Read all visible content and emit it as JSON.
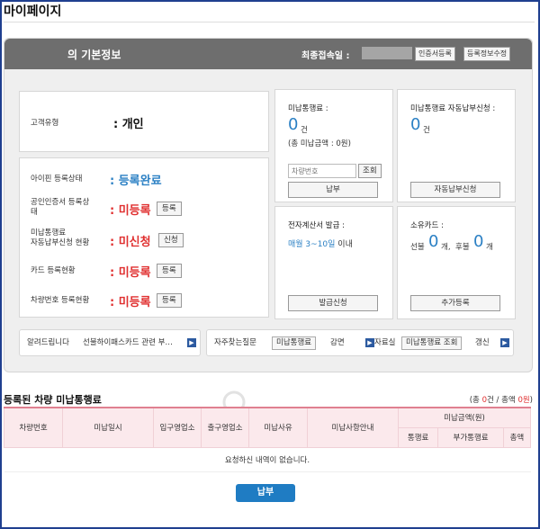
{
  "page": {
    "title": "마이페이지"
  },
  "basic": {
    "title": "의 기본정보",
    "last_login_label": "최종접속일 :",
    "cert_register_btn": "인증서등록",
    "edit_info_btn": "등록정보수정"
  },
  "customer": {
    "type_label": "고객유형",
    "type_value": ": 개인"
  },
  "status": {
    "ipin_label": "아이핀 등록상태",
    "ipin_value": ": 등록완료",
    "cert_label_1": "공인인증서 등록상",
    "cert_label_2": "태",
    "cert_value": ": 미등록",
    "cert_btn": "등록",
    "auto_label_1": "미납통행료",
    "auto_label_2": "자동납부신청 현황",
    "auto_value": ": 미신청",
    "auto_btn": "신청",
    "card_label": "카드 등록현황",
    "card_value": ": 미등록",
    "card_btn": "등록",
    "car_label": "차량번호 등록현황",
    "car_value": ": 미등록",
    "car_btn": "등록"
  },
  "unpaid": {
    "title": "미납통행료 :",
    "count": "0",
    "unit": "건",
    "total": "(총 미납금액 : 0원)",
    "car_placeholder": "차량번호",
    "search_btn": "조회",
    "pay_btn": "납부"
  },
  "auto_pay": {
    "title": "미납통행료 자동납부신청 :",
    "count": "0",
    "unit": "건",
    "btn": "자동납부신청"
  },
  "einvoice": {
    "title": "전자계산서 발급 :",
    "date": "매월 3~10일",
    "date_suffix": " 이내",
    "btn": "발급신청"
  },
  "cards": {
    "title": "소유카드 :",
    "prepaid_label": "선불",
    "prepaid_count": "0",
    "prepaid_unit": "개,",
    "postpaid_label": "후불",
    "postpaid_count": "0",
    "postpaid_unit": "개",
    "btn": "추가등록"
  },
  "notice": {
    "label": "알려드립니다",
    "text": "선불하이패스카드 관련 부…"
  },
  "faq": {
    "label": "자주찾는질문",
    "tags": [
      "미납통행료",
      "감면"
    ]
  },
  "library": {
    "label": "자료실",
    "tags": [
      "미납통행료 조회",
      "갱신"
    ]
  },
  "section": {
    "title": "등록된 차량 미납통행료",
    "summary_prefix": "(총 ",
    "summary_count": "0",
    "summary_mid": "건 / 총액 ",
    "summary_amount": "0원",
    "summary_suffix": ")"
  },
  "table": {
    "headers": [
      "차량번호",
      "미납일시",
      "입구영업소",
      "출구영업소",
      "미납사유",
      "미납사항안내"
    ],
    "amount_group": "미납금액(원)",
    "amount_sub": [
      "통행료",
      "부가통행료",
      "총액"
    ],
    "empty": "요청하신 내역이 없습니다."
  },
  "bottom": {
    "pay_btn": "납부"
  }
}
